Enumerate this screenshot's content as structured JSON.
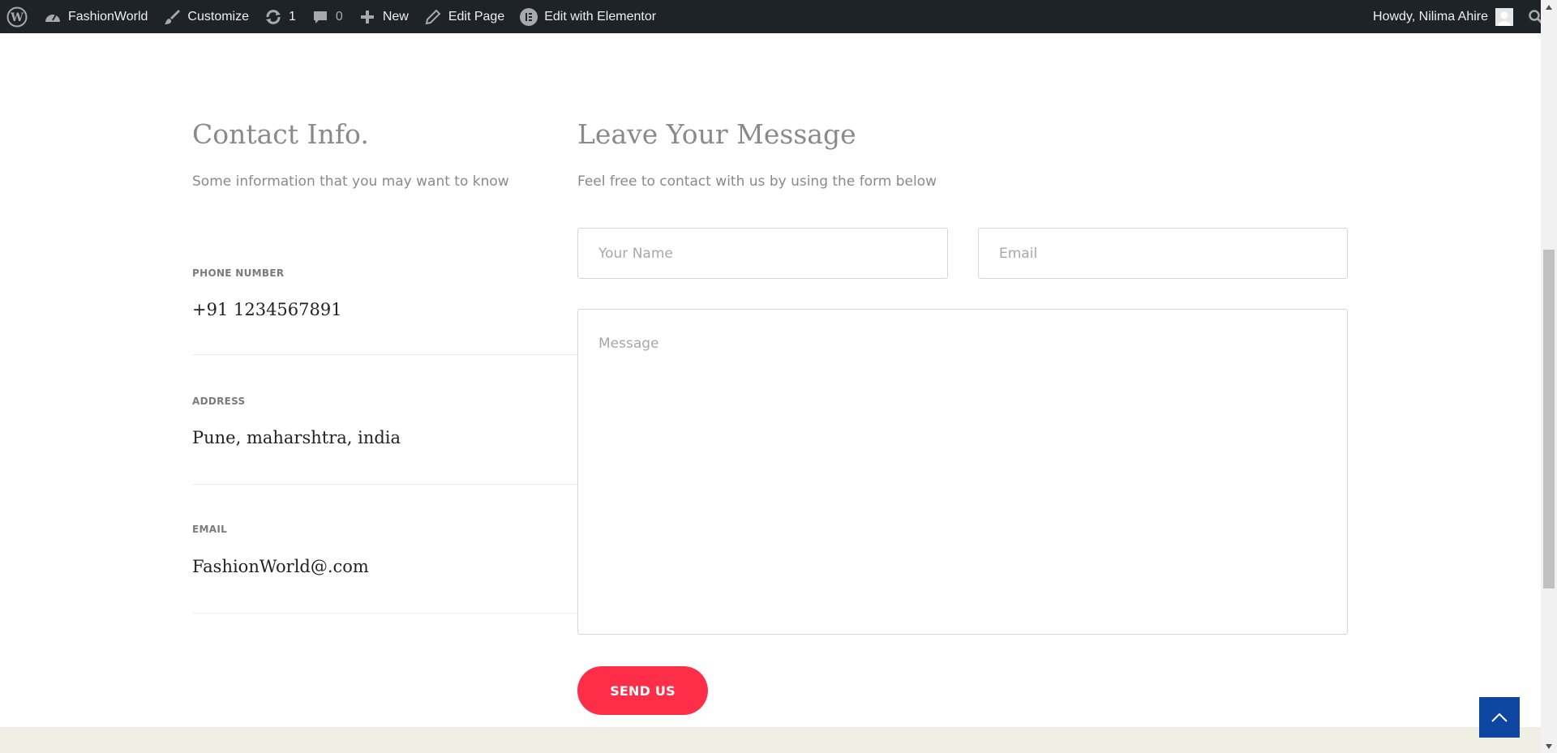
{
  "adminbar": {
    "site_name": "FashionWorld",
    "customize": "Customize",
    "updates_count": "1",
    "comments_count": "0",
    "new": "New",
    "edit_page": "Edit Page",
    "edit_elementor": "Edit with Elementor",
    "greeting": "Howdy, Nilima Ahire"
  },
  "contact_info": {
    "title": "Contact Info.",
    "subtitle": "Some information that you may want to know",
    "items": [
      {
        "label": "PHONE NUMBER",
        "value": "+91 1234567891"
      },
      {
        "label": "ADDRESS",
        "value": "Pune, maharshtra, india"
      },
      {
        "label": "EMAIL",
        "value": "FashionWorld@.com"
      }
    ]
  },
  "message_form": {
    "title": "Leave Your Message",
    "subtitle": "Feel free to contact with us by using the form below",
    "name_placeholder": "Your Name",
    "email_placeholder": "Email",
    "message_placeholder": "Message",
    "submit_label": "SEND US"
  },
  "colors": {
    "adminbar_bg": "#1d2327",
    "accent_button": "#ff2e48",
    "scroll_top_button": "#0d47a1",
    "footer_strip": "#efefe6"
  },
  "icons": [
    "wordpress-icon",
    "dashboard-icon",
    "brush-icon",
    "updates-icon",
    "comment-icon",
    "plus-icon",
    "pencil-icon",
    "elementor-icon",
    "avatar-icon",
    "search-icon",
    "chevron-up-icon"
  ]
}
